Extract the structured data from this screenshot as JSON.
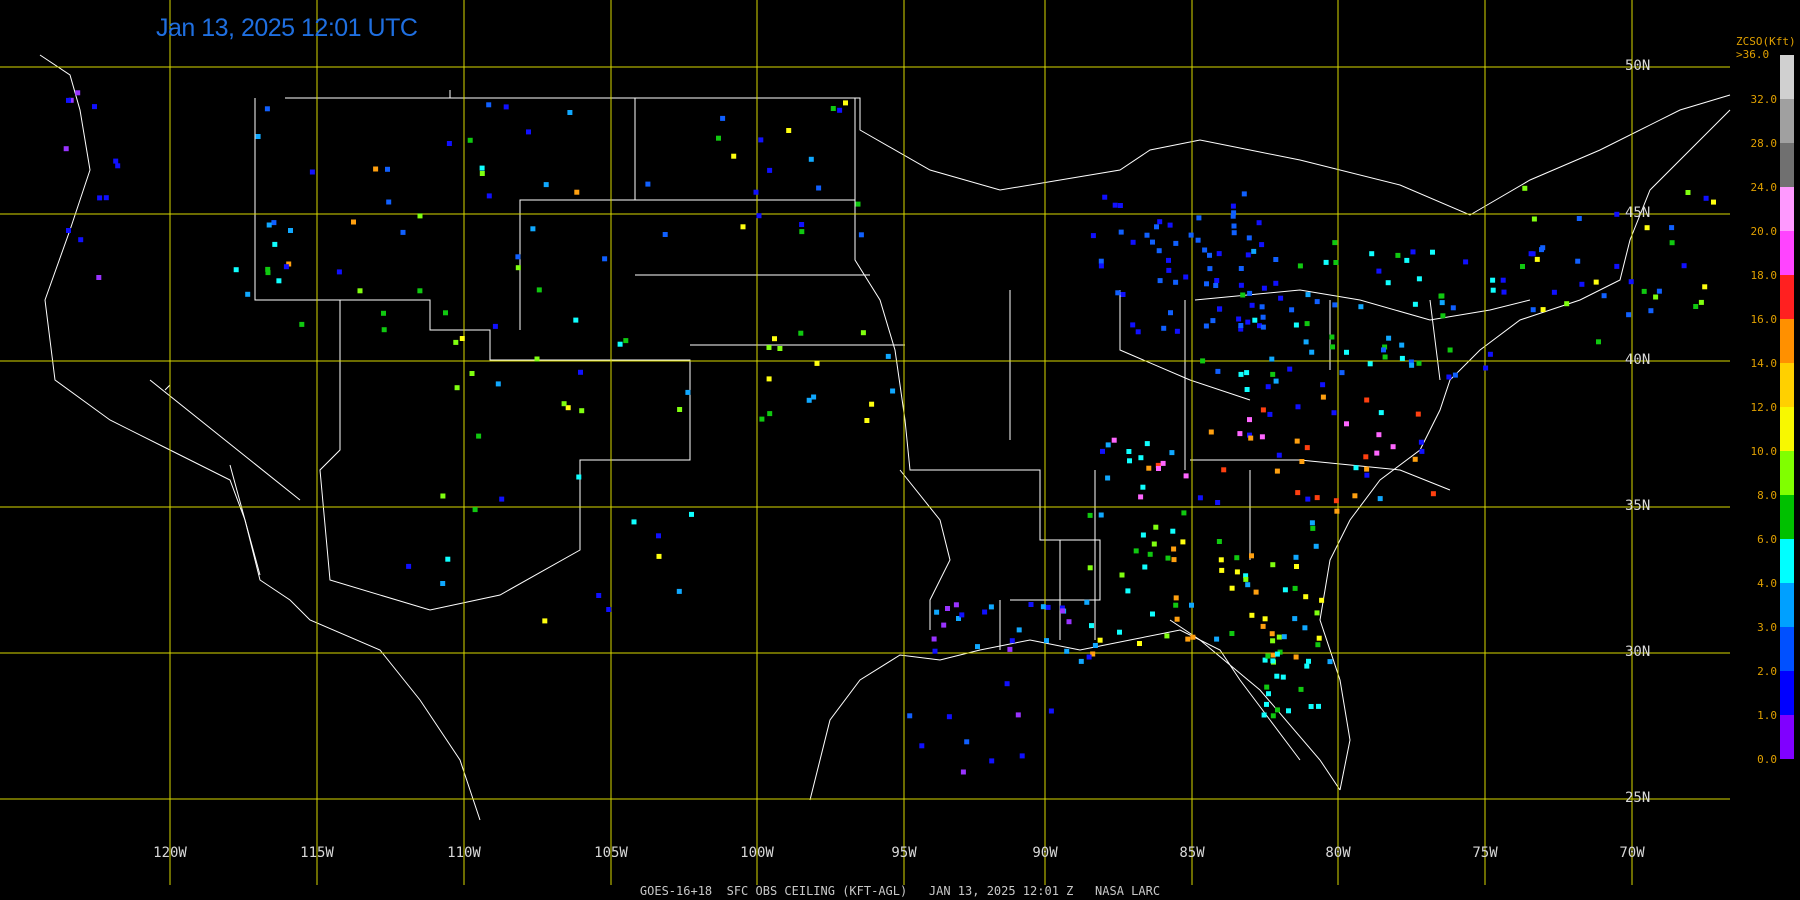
{
  "title": "Jan 13, 2025 12:01 UTC",
  "footer": "GOES-16+18  SFC OBS CEILING (KFT-AGL)   JAN 13, 2025 12:01 Z   NASA LARC",
  "latitudes": [
    "50N",
    "45N",
    "40N",
    "35N",
    "30N",
    "25N"
  ],
  "longitudes": [
    "120W",
    "115W",
    "110W",
    "105W",
    "100W",
    "95W",
    "90W",
    "85W",
    "80W",
    "75W",
    "70W"
  ],
  "legend": {
    "title": [
      "ZCSO(Kft)",
      ">36.0"
    ],
    "ticks": [
      "32.0",
      "28.0",
      "24.0",
      "20.0",
      "18.0",
      "16.0",
      "14.0",
      "12.0",
      "10.0",
      "8.0",
      "6.0",
      "4.0",
      "3.0",
      "2.0",
      "1.0",
      "0.0"
    ],
    "colors": [
      "#d0d0d0",
      "#a0a0a0",
      "#707070",
      "#ff99ff",
      "#ff44ff",
      "#ff2020",
      "#ff9000",
      "#ffd000",
      "#f8f800",
      "#80ff00",
      "#00c000",
      "#00ffff",
      "#00a0ff",
      "#0050ff",
      "#0000ff",
      "#8000ff"
    ]
  },
  "colors": {
    "grid": "#d8d800",
    "border": "#ffffff",
    "station_0_1": "#9933ff",
    "station_1_2": "#1010ff",
    "station_2_3": "#1060ff",
    "station_3_4": "#10a8ff",
    "station_4_6": "#10ffff",
    "station_6_8": "#10c810",
    "station_8_10": "#80ff10",
    "station_10_12": "#ffff10",
    "station_14_16": "#ffa010",
    "station_16_18": "#ff4010",
    "station_20_24": "#ff66ff"
  }
}
